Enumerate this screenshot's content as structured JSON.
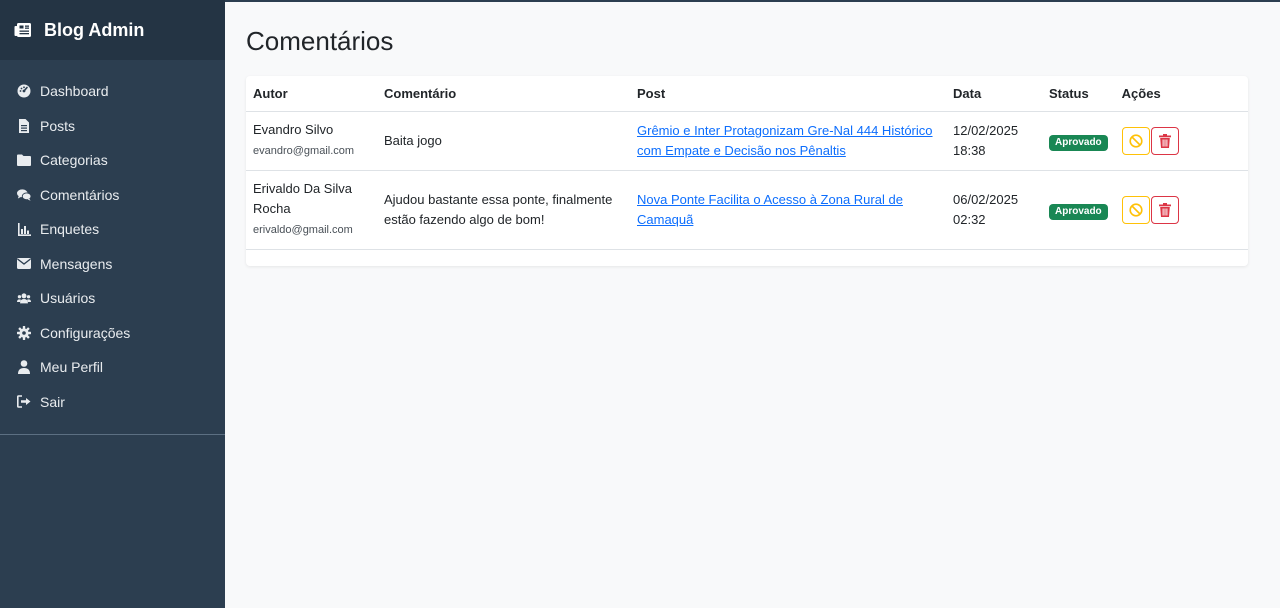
{
  "brand": "Blog Admin",
  "nav": [
    {
      "label": "Dashboard",
      "icon": "dashboard-icon"
    },
    {
      "label": "Posts",
      "icon": "file-icon"
    },
    {
      "label": "Categorias",
      "icon": "folder-icon"
    },
    {
      "label": "Comentários",
      "icon": "comments-icon"
    },
    {
      "label": "Enquetes",
      "icon": "chart-icon"
    },
    {
      "label": "Mensagens",
      "icon": "envelope-icon"
    },
    {
      "label": "Usuários",
      "icon": "users-icon"
    },
    {
      "label": "Configurações",
      "icon": "gear-icon"
    },
    {
      "label": "Meu Perfil",
      "icon": "user-icon"
    },
    {
      "label": "Sair",
      "icon": "sign-out-icon"
    }
  ],
  "page_title": "Comentários",
  "table": {
    "headers": {
      "author": "Autor",
      "comment": "Comentário",
      "post": "Post",
      "date": "Data",
      "status": "Status",
      "actions": "Ações"
    },
    "rows": [
      {
        "author": "Evandro Silvo",
        "email": "evandro@gmail.com",
        "comment": "Baita jogo",
        "post": "Grêmio e Inter Protagonizam Gre-Nal 444 Histórico com Empate e Decisão nos Pênaltis",
        "date": "12/02/2025",
        "time": "18:38",
        "status": "Aprovado"
      },
      {
        "author": "Erivaldo Da Silva Rocha",
        "email": "erivaldo@gmail.com",
        "comment": "Ajudou bastante essa ponte, finalmente estão fazendo algo de bom!",
        "post": "Nova Ponte Facilita o Acesso à Zona Rural de Camaquã",
        "date": "06/02/2025",
        "time": "02:32",
        "status": "Aprovado"
      }
    ]
  },
  "colors": {
    "sidebar": "#2c3e50",
    "brand_bg": "#243444",
    "approved": "#198754",
    "warning": "#ffc107",
    "danger": "#dc3545",
    "link": "#0d6efd"
  }
}
